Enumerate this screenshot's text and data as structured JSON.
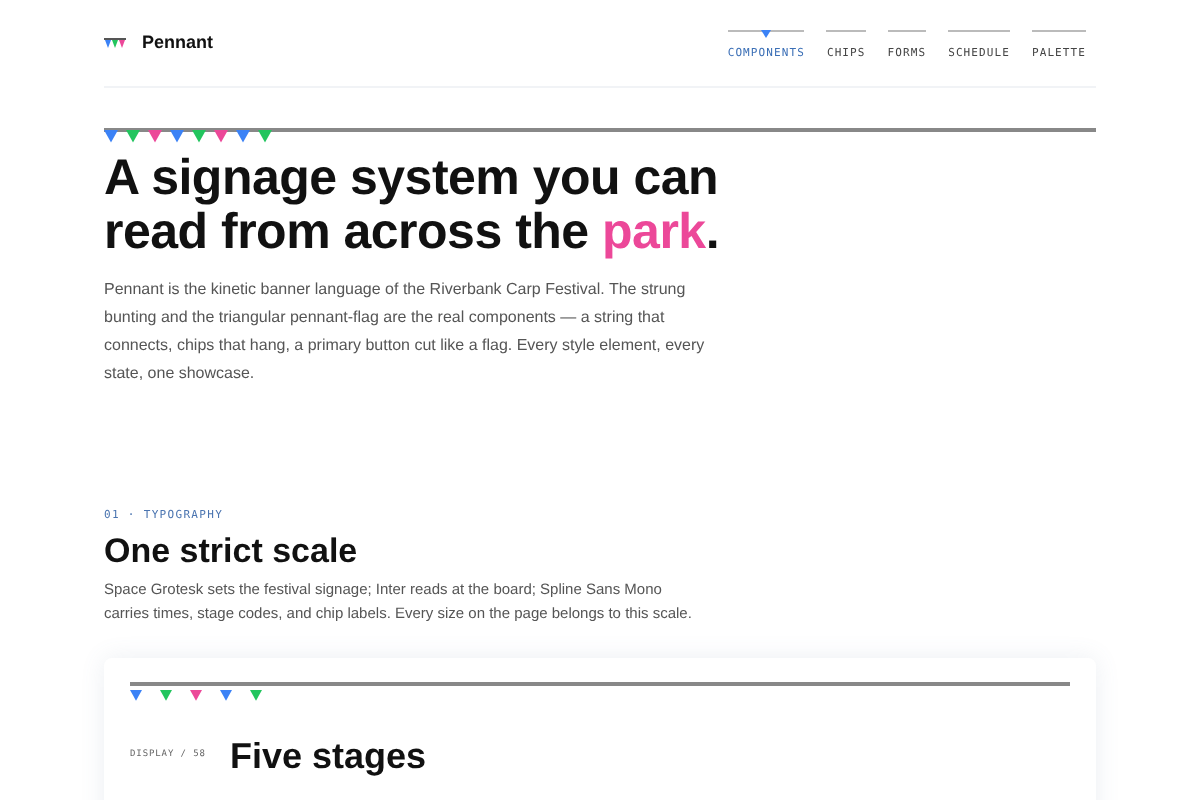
{
  "brand": {
    "name": "Pennant"
  },
  "nav": [
    {
      "label": "COMPONENTS",
      "selected": true
    },
    {
      "label": "CHIPS",
      "selected": false
    },
    {
      "label": "FORMS",
      "selected": false
    },
    {
      "label": "SCHEDULE",
      "selected": false
    },
    {
      "label": "PALETTE",
      "selected": false
    }
  ],
  "hero": {
    "flags": [
      {
        "color": "#3b82f6"
      },
      {
        "color": "#22c55e"
      },
      {
        "color": "#ec4899"
      },
      {
        "color": "#3b82f6"
      },
      {
        "color": "#22c55e"
      },
      {
        "color": "#ec4899"
      },
      {
        "color": "#3b82f6"
      },
      {
        "color": "#22c55e"
      }
    ],
    "title": "A signage system you can read from across the",
    "highlight": "park",
    "title_end": ".",
    "text": "Pennant is the kinetic banner language of the Riverbank Carp Festival. The strung bunting and the triangular pennant-flag are the real components — a string that connects, chips that hang, a primary button cut like a flag. Every style element, every state, one showcase."
  },
  "section": {
    "eyebrow": "01 · TYPOGRAPHY",
    "title": "One strict scale",
    "text": "Space Grotesk sets the festival signage; Inter reads at the board; Spline Sans Mono carries times, stage codes, and chip labels. Every size on the page belongs to this scale."
  },
  "card": {
    "flags": [
      {
        "color": "#3b82f6"
      },
      {
        "color": "#22c55e"
      },
      {
        "color": "#ec4899"
      },
      {
        "color": "#3b82f6"
      },
      {
        "color": "#22c55e"
      }
    ],
    "rows": [
      {
        "label": "DISPLAY / 58",
        "sample": "Five stages"
      }
    ]
  }
}
